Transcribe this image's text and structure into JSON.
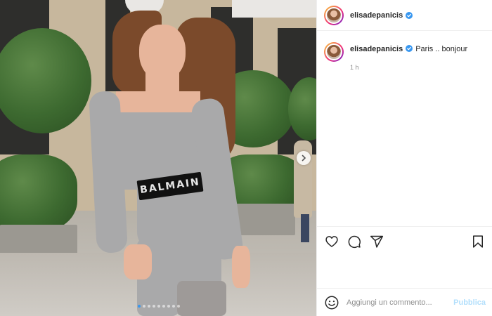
{
  "post": {
    "photo_text": "BALMAIN",
    "carousel": {
      "slide_count": 9,
      "active_index": 0
    },
    "next_icon": "chevron-right-icon"
  },
  "header": {
    "username": "elisadepanicis",
    "verified_icon": "verified-badge-icon"
  },
  "caption": {
    "username": "elisadepanicis",
    "text": "Paris .. bonjour",
    "time": "1 h"
  },
  "actions": {
    "icons": [
      "heart-icon",
      "comment-icon",
      "share-icon",
      "bookmark-icon"
    ]
  },
  "comment_box": {
    "placeholder": "Aggiungi un commento...",
    "publish_label": "Pubblica",
    "emoji_icon": "emoji-icon"
  },
  "colors": {
    "link_blue": "#3897f0",
    "publish_disabled": "#b2dffc",
    "text": "#262626",
    "muted": "#8e8e8e",
    "divider": "#efefef"
  }
}
